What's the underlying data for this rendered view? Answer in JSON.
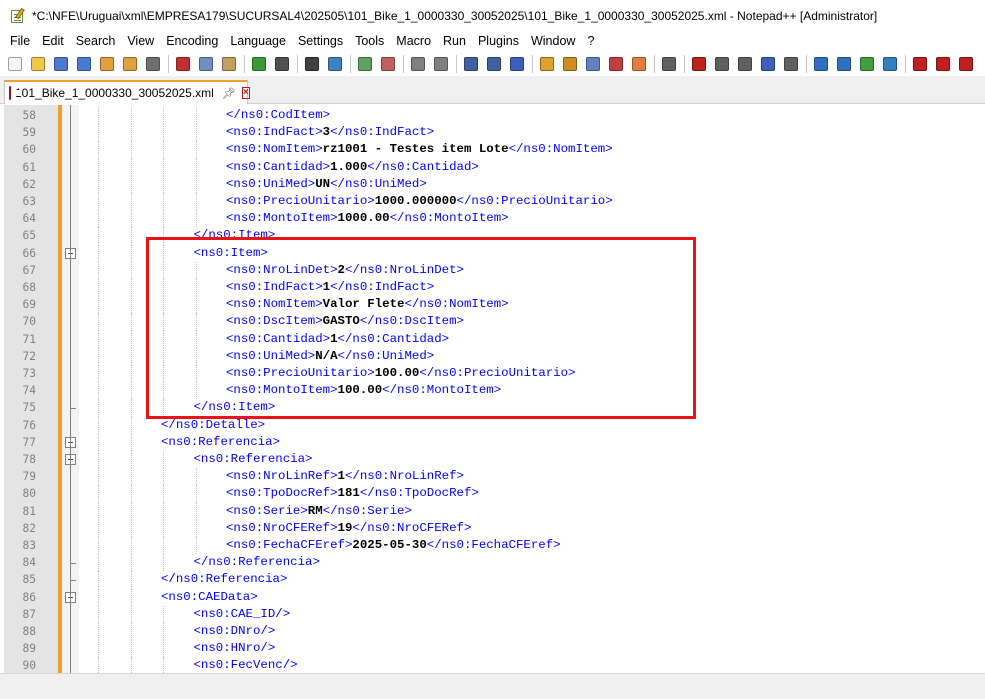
{
  "window": {
    "title": "*C:\\NFE\\Uruguai\\xml\\EMPRESA179\\SUCURSAL4\\202505\\101_Bike_1_0000330_30052025\\101_Bike_1_0000330_30052025.xml - Notepad++ [Administrator]"
  },
  "menu": [
    "File",
    "Edit",
    "Search",
    "View",
    "Encoding",
    "Language",
    "Settings",
    "Tools",
    "Macro",
    "Run",
    "Plugins",
    "Window",
    "?"
  ],
  "toolbar": {
    "icons": [
      {
        "name": "new-file-icon",
        "color": "#f5f5f5"
      },
      {
        "name": "open-file-icon",
        "color": "#f2c94c"
      },
      {
        "name": "save-icon",
        "color": "#4a7bd0"
      },
      {
        "name": "save-all-icon",
        "color": "#4a7bd0"
      },
      {
        "name": "close-icon",
        "color": "#e0a040"
      },
      {
        "name": "close-all-icon",
        "color": "#e0a040"
      },
      {
        "name": "print-icon",
        "color": "#707070"
      },
      {
        "name": "cut-icon",
        "color": "#c03030"
      },
      {
        "name": "copy-icon",
        "color": "#7090c0"
      },
      {
        "name": "paste-icon",
        "color": "#c0a060"
      },
      {
        "name": "undo-icon",
        "color": "#3a9a3a"
      },
      {
        "name": "redo-icon",
        "color": "#505050"
      },
      {
        "name": "find-icon",
        "color": "#404040"
      },
      {
        "name": "replace-icon",
        "color": "#4080c0"
      },
      {
        "name": "zoom-in-icon",
        "color": "#60a060"
      },
      {
        "name": "zoom-out-icon",
        "color": "#c06060"
      },
      {
        "name": "sync-vertical-icon",
        "color": "#808080"
      },
      {
        "name": "sync-horizontal-icon",
        "color": "#808080"
      },
      {
        "name": "word-wrap-icon",
        "color": "#4060a0"
      },
      {
        "name": "all-chars-icon",
        "color": "#4060a0"
      },
      {
        "name": "indent-guide-icon",
        "color": "#4060c0"
      },
      {
        "name": "udl-icon",
        "color": "#e0a030"
      },
      {
        "name": "doc-map-icon",
        "color": "#d09020"
      },
      {
        "name": "doc-list-icon",
        "color": "#6080c0"
      },
      {
        "name": "function-list-icon",
        "color": "#c04040"
      },
      {
        "name": "folder-workspace-icon",
        "color": "#e08040"
      },
      {
        "name": "monitoring-icon",
        "color": "#606060"
      },
      {
        "name": "record-macro-icon",
        "color": "#c02020"
      },
      {
        "name": "stop-macro-icon",
        "color": "#606060"
      },
      {
        "name": "play-macro-icon",
        "color": "#606060"
      },
      {
        "name": "run-macro-multiple-icon",
        "color": "#4060c0"
      },
      {
        "name": "save-macro-icon",
        "color": "#606060"
      },
      {
        "name": "json-icon",
        "color": "#3070c0"
      },
      {
        "name": "xml-tools-icon",
        "color": "#3070c0"
      },
      {
        "name": "check-icon",
        "color": "#40a040"
      },
      {
        "name": "compare-icon",
        "color": "#3080c0"
      },
      {
        "name": "first-icon",
        "color": "#c02020"
      },
      {
        "name": "prev-icon",
        "color": "#c02020"
      },
      {
        "name": "next-icon",
        "color": "#c02020"
      }
    ]
  },
  "tab": {
    "label": "101_Bike_1_0000330_30052025.xml"
  },
  "editor": {
    "lines": [
      {
        "n": "58",
        "indent": 5,
        "parts": [
          {
            "t": "tag",
            "s": "</ns0:CodItem>"
          }
        ]
      },
      {
        "n": "59",
        "indent": 5,
        "parts": [
          {
            "t": "tag",
            "s": "<ns0:IndFact>"
          },
          {
            "t": "val",
            "s": "3"
          },
          {
            "t": "tag",
            "s": "</ns0:IndFact>"
          }
        ]
      },
      {
        "n": "60",
        "indent": 5,
        "parts": [
          {
            "t": "tag",
            "s": "<ns0:NomItem>"
          },
          {
            "t": "val",
            "s": "rz1001 - Testes item Lote"
          },
          {
            "t": "tag",
            "s": "</ns0:NomItem>"
          }
        ]
      },
      {
        "n": "61",
        "indent": 5,
        "parts": [
          {
            "t": "tag",
            "s": "<ns0:Cantidad>"
          },
          {
            "t": "val",
            "s": "1.000"
          },
          {
            "t": "tag",
            "s": "</ns0:Cantidad>"
          }
        ]
      },
      {
        "n": "62",
        "indent": 5,
        "parts": [
          {
            "t": "tag",
            "s": "<ns0:UniMed>"
          },
          {
            "t": "val",
            "s": "UN"
          },
          {
            "t": "tag",
            "s": "</ns0:UniMed>"
          }
        ]
      },
      {
        "n": "63",
        "indent": 5,
        "parts": [
          {
            "t": "tag",
            "s": "<ns0:PrecioUnitario>"
          },
          {
            "t": "val",
            "s": "1000.000000"
          },
          {
            "t": "tag",
            "s": "</ns0:PrecioUnitario>"
          }
        ]
      },
      {
        "n": "64",
        "indent": 5,
        "parts": [
          {
            "t": "tag",
            "s": "<ns0:MontoItem>"
          },
          {
            "t": "val",
            "s": "1000.00"
          },
          {
            "t": "tag",
            "s": "</ns0:MontoItem>"
          }
        ]
      },
      {
        "n": "65",
        "indent": 4,
        "parts": [
          {
            "t": "tag",
            "s": "</ns0:Item>"
          }
        ]
      },
      {
        "n": "66",
        "indent": 4,
        "fold": "open",
        "parts": [
          {
            "t": "tag",
            "s": "<ns0:Item>"
          }
        ]
      },
      {
        "n": "67",
        "indent": 5,
        "parts": [
          {
            "t": "tag",
            "s": "<ns0:NroLinDet>"
          },
          {
            "t": "val",
            "s": "2"
          },
          {
            "t": "tag",
            "s": "</ns0:NroLinDet>"
          }
        ]
      },
      {
        "n": "68",
        "indent": 5,
        "parts": [
          {
            "t": "tag",
            "s": "<ns0:IndFact>"
          },
          {
            "t": "val",
            "s": "1"
          },
          {
            "t": "tag",
            "s": "</ns0:IndFact>"
          }
        ]
      },
      {
        "n": "69",
        "indent": 5,
        "parts": [
          {
            "t": "tag",
            "s": "<ns0:NomItem>"
          },
          {
            "t": "val",
            "s": "Valor Flete"
          },
          {
            "t": "tag",
            "s": "</ns0:NomItem>"
          }
        ]
      },
      {
        "n": "70",
        "indent": 5,
        "parts": [
          {
            "t": "tag",
            "s": "<ns0:DscItem>"
          },
          {
            "t": "val",
            "s": "GASTO"
          },
          {
            "t": "tag",
            "s": "</ns0:DscItem>"
          }
        ]
      },
      {
        "n": "71",
        "indent": 5,
        "parts": [
          {
            "t": "tag",
            "s": "<ns0:Cantidad>"
          },
          {
            "t": "val",
            "s": "1"
          },
          {
            "t": "tag",
            "s": "</ns0:Cantidad>"
          }
        ]
      },
      {
        "n": "72",
        "indent": 5,
        "parts": [
          {
            "t": "tag",
            "s": "<ns0:UniMed>"
          },
          {
            "t": "val",
            "s": "N/A"
          },
          {
            "t": "tag",
            "s": "</ns0:UniMed>"
          }
        ]
      },
      {
        "n": "73",
        "indent": 5,
        "parts": [
          {
            "t": "tag",
            "s": "<ns0:PrecioUnitario>"
          },
          {
            "t": "val",
            "s": "100.00"
          },
          {
            "t": "tag",
            "s": "</ns0:PrecioUnitario>"
          }
        ]
      },
      {
        "n": "74",
        "indent": 5,
        "parts": [
          {
            "t": "tag",
            "s": "<ns0:MontoItem>"
          },
          {
            "t": "val",
            "s": "100.00"
          },
          {
            "t": "tag",
            "s": "</ns0:MontoItem>"
          }
        ]
      },
      {
        "n": "75",
        "indent": 4,
        "fold": "end",
        "parts": [
          {
            "t": "tag",
            "s": "</ns0:Item>"
          }
        ]
      },
      {
        "n": "76",
        "indent": 3,
        "parts": [
          {
            "t": "tag",
            "s": "</ns0:Detalle>"
          }
        ]
      },
      {
        "n": "77",
        "indent": 3,
        "fold": "open",
        "parts": [
          {
            "t": "tag",
            "s": "<ns0:Referencia>"
          }
        ]
      },
      {
        "n": "78",
        "indent": 4,
        "fold": "open",
        "parts": [
          {
            "t": "tag",
            "s": "<ns0:Referencia>"
          }
        ]
      },
      {
        "n": "79",
        "indent": 5,
        "parts": [
          {
            "t": "tag",
            "s": "<ns0:NroLinRef>"
          },
          {
            "t": "val",
            "s": "1"
          },
          {
            "t": "tag",
            "s": "</ns0:NroLinRef>"
          }
        ]
      },
      {
        "n": "80",
        "indent": 5,
        "parts": [
          {
            "t": "tag",
            "s": "<ns0:TpoDocRef>"
          },
          {
            "t": "val",
            "s": "181"
          },
          {
            "t": "tag",
            "s": "</ns0:TpoDocRef>"
          }
        ]
      },
      {
        "n": "81",
        "indent": 5,
        "parts": [
          {
            "t": "tag",
            "s": "<ns0:Serie>"
          },
          {
            "t": "val",
            "s": "RM"
          },
          {
            "t": "tag",
            "s": "</ns0:Serie>"
          }
        ]
      },
      {
        "n": "82",
        "indent": 5,
        "parts": [
          {
            "t": "tag",
            "s": "<ns0:NroCFERef>"
          },
          {
            "t": "val",
            "s": "19"
          },
          {
            "t": "tag",
            "s": "</ns0:NroCFERef>"
          }
        ]
      },
      {
        "n": "83",
        "indent": 5,
        "parts": [
          {
            "t": "tag",
            "s": "<ns0:FechaCFEref>"
          },
          {
            "t": "val",
            "s": "2025-05-30"
          },
          {
            "t": "tag",
            "s": "</ns0:FechaCFEref>"
          }
        ]
      },
      {
        "n": "84",
        "indent": 4,
        "fold": "end",
        "parts": [
          {
            "t": "tag",
            "s": "</ns0:Referencia>"
          }
        ]
      },
      {
        "n": "85",
        "indent": 3,
        "fold": "end",
        "parts": [
          {
            "t": "tag",
            "s": "</ns0:Referencia>"
          }
        ]
      },
      {
        "n": "86",
        "indent": 3,
        "fold": "open",
        "parts": [
          {
            "t": "tag",
            "s": "<ns0:CAEData>"
          }
        ]
      },
      {
        "n": "87",
        "indent": 4,
        "parts": [
          {
            "t": "tag",
            "s": "<ns0:CAE_ID/>"
          }
        ]
      },
      {
        "n": "88",
        "indent": 4,
        "parts": [
          {
            "t": "tag",
            "s": "<ns0:DNro/>"
          }
        ]
      },
      {
        "n": "89",
        "indent": 4,
        "parts": [
          {
            "t": "tag",
            "s": "<ns0:HNro/>"
          }
        ]
      },
      {
        "n": "90",
        "indent": 4,
        "parts": [
          {
            "t": "tag",
            "s": "<ns0:FecVenc/>"
          }
        ]
      }
    ]
  },
  "colors": {
    "tag": "#0000ff",
    "value": "#000000",
    "highlight": "#e8141a",
    "changed_line_marker": "#f0a030"
  }
}
